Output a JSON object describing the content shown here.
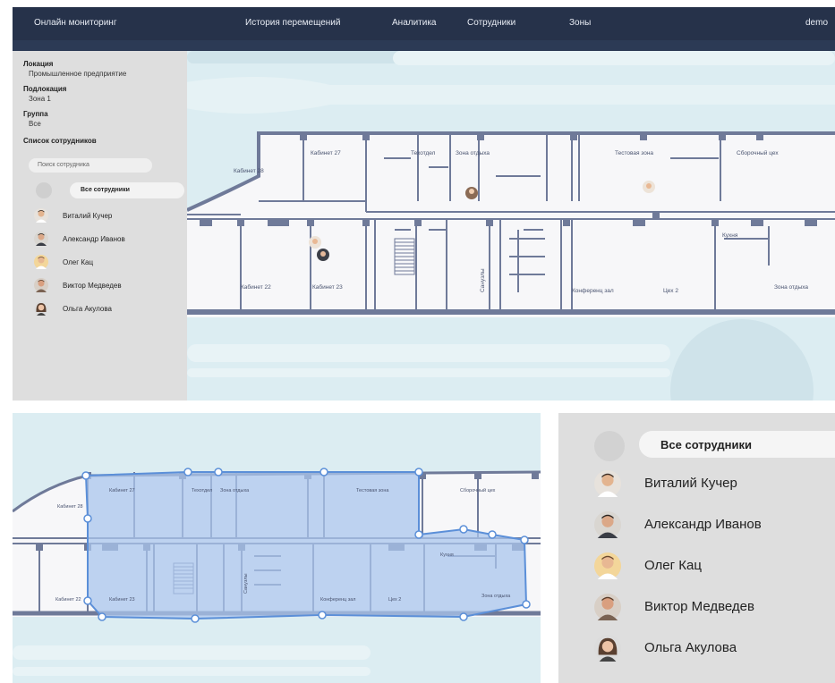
{
  "nav": {
    "online": "Онлайн мониторинг",
    "history": "История перемещений",
    "analytics": "Аналитика",
    "employees": "Сотрудники",
    "zones": "Зоны",
    "user": "demo"
  },
  "sidebar": {
    "location_label": "Локация",
    "location_value": "Промышленное предприятие",
    "sublocation_label": "Подлокация",
    "sublocation_value": "Зона 1",
    "group_label": "Группа",
    "group_value": "Все",
    "list_label": "Список сотрудников",
    "search_placeholder": "Поиск сотрудника",
    "all_button": "Все сотрудники",
    "employees": [
      {
        "name": "Виталий Кучер",
        "avatar": "male-avatar-icon"
      },
      {
        "name": "Александр Иванов",
        "avatar": "male-avatar-icon"
      },
      {
        "name": "Олег Кац",
        "avatar": "male-avatar-icon"
      },
      {
        "name": "Виктор Медведев",
        "avatar": "male-avatar-icon"
      },
      {
        "name": "Ольга Акулова",
        "avatar": "female-avatar-icon"
      }
    ]
  },
  "rooms": {
    "r28": "Кабинет 28",
    "r27": "Кабинет 27",
    "tech": "Техотдел",
    "rest": "Зона отдыха",
    "test": "Тестовая зона",
    "assembly": "Сборочный цех",
    "r22": "Кабинет 22",
    "r23": "Кабинет 23",
    "wc": "Санузлы",
    "conf": "Конференц зал",
    "shop2": "Цех 2",
    "kitchen": "Кухня",
    "rest2": "Зона отдыха"
  },
  "colors": {
    "nav_bg": "#26324a",
    "map_bg": "#dcedf2",
    "walls": "#6f7a99",
    "room_fill": "#f7f7f9",
    "zone_fill": "#a9c6ec",
    "zone_stroke": "#5b8fd8"
  }
}
